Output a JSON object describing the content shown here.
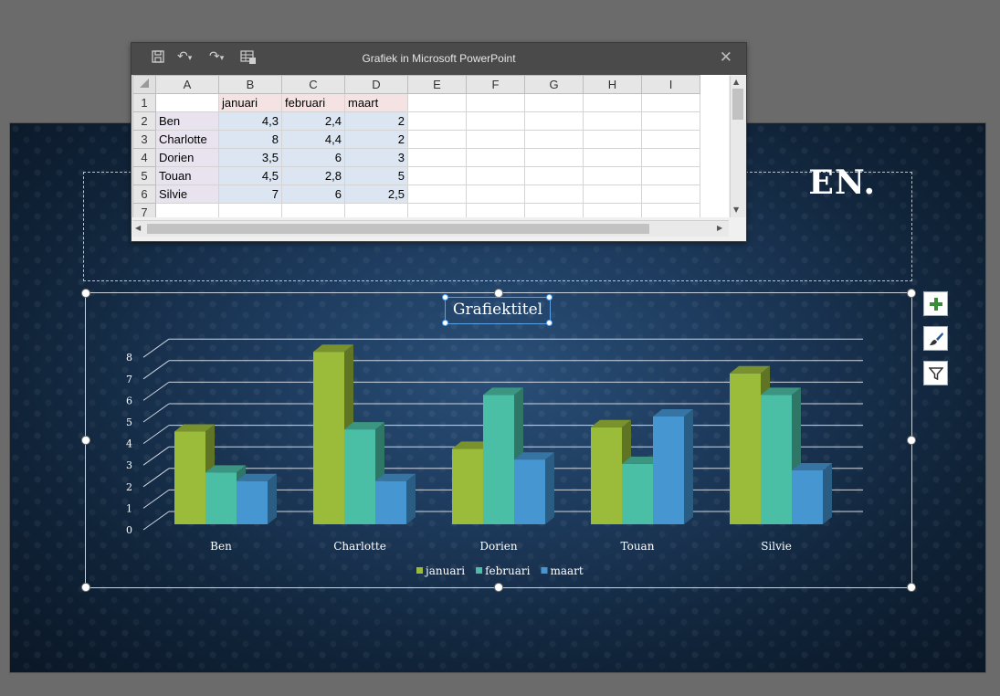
{
  "slide": {
    "title_visible_fragment": "EN."
  },
  "excel": {
    "window_title": "Grafiek in Microsoft PowerPoint",
    "columns": [
      "A",
      "B",
      "C",
      "D",
      "E",
      "F",
      "G",
      "H",
      "I"
    ],
    "rows": [
      {
        "n": "1",
        "a": "",
        "b": "januari",
        "c": "februari",
        "d": "maart"
      },
      {
        "n": "2",
        "a": "Ben",
        "b": "4,3",
        "c": "2,4",
        "d": "2"
      },
      {
        "n": "3",
        "a": "Charlotte",
        "b": "8",
        "c": "4,4",
        "d": "2"
      },
      {
        "n": "4",
        "a": "Dorien",
        "b": "3,5",
        "c": "6",
        "d": "3"
      },
      {
        "n": "5",
        "a": "Touan",
        "b": "4,5",
        "c": "2,8",
        "d": "5"
      },
      {
        "n": "6",
        "a": "Silvie",
        "b": "7",
        "c": "6",
        "d": "2,5"
      },
      {
        "n": "7",
        "a": "",
        "b": "",
        "c": "",
        "d": ""
      }
    ],
    "icons": {
      "save": "save-icon",
      "undo": "undo-icon",
      "redo": "redo-icon",
      "edit_data": "edit-data-in-excel-icon",
      "close": "close-icon"
    }
  },
  "chart_tools": {
    "add": "chart-elements-icon",
    "style": "chart-styles-icon",
    "filter": "chart-filters-icon"
  },
  "chart_data": {
    "type": "bar",
    "title": "Grafiektitel",
    "categories": [
      "Ben",
      "Charlotte",
      "Dorien",
      "Touan",
      "Silvie"
    ],
    "series": [
      {
        "name": "januari",
        "values": [
          4.3,
          8,
          3.5,
          4.5,
          7
        ],
        "color": "#9bbb3b"
      },
      {
        "name": "februari",
        "values": [
          2.4,
          4.4,
          6,
          2.8,
          6
        ],
        "color": "#4bbfa5"
      },
      {
        "name": "maart",
        "values": [
          2,
          2,
          3,
          5,
          2.5
        ],
        "color": "#4596d1"
      }
    ],
    "ylim": [
      0,
      8
    ],
    "yticks": [
      "0",
      "1",
      "2",
      "3",
      "4",
      "5",
      "6",
      "7",
      "8"
    ],
    "grid": true,
    "legend": "bottom",
    "style": "3d-clustered-column"
  }
}
